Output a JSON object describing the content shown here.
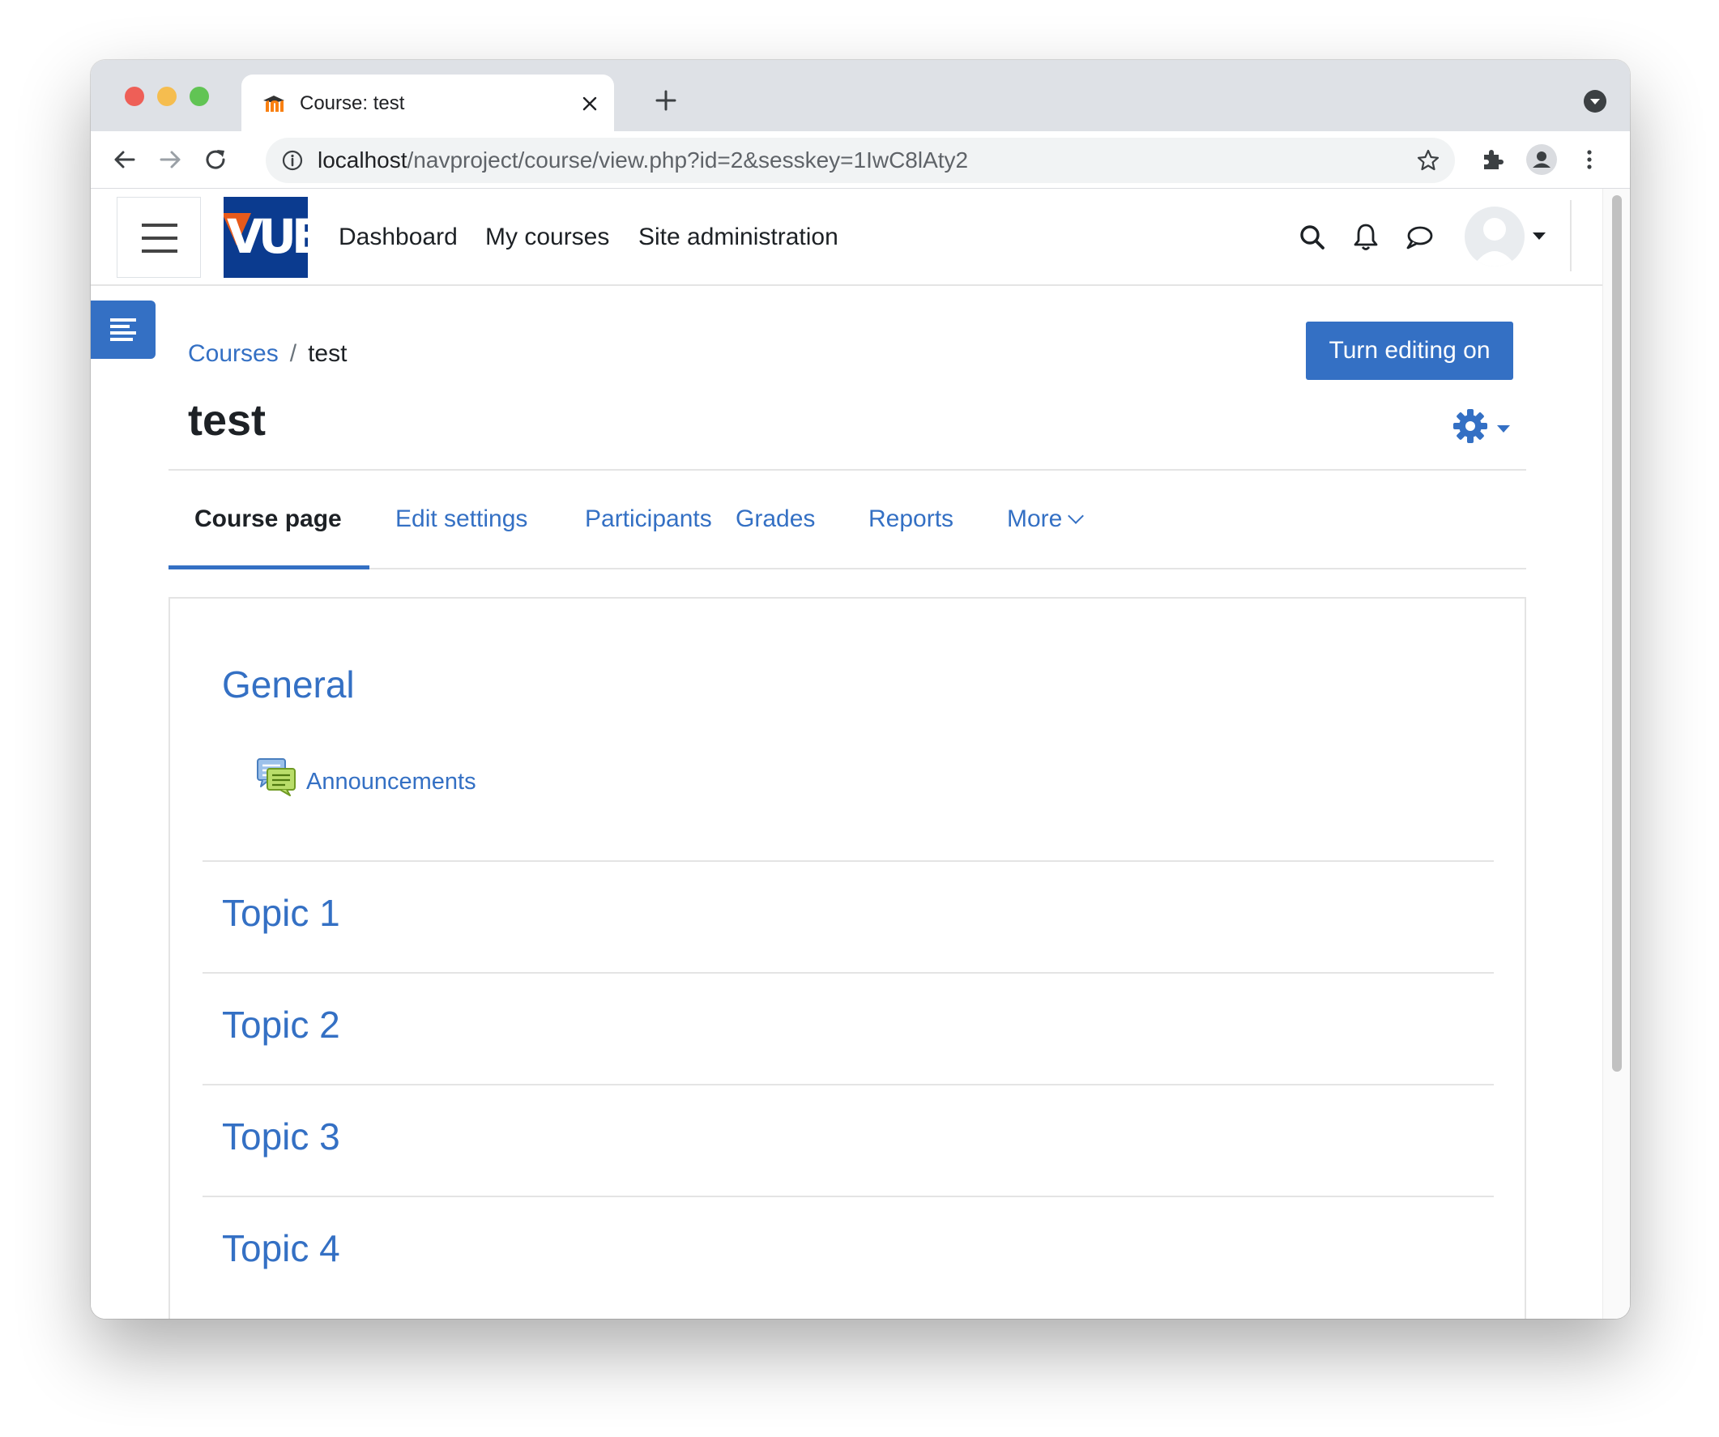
{
  "browser": {
    "tab_title": "Course: test",
    "url_host": "localhost",
    "url_path": "/navproject/course/view.php?id=2&sesskey=1IwC8lAty2"
  },
  "navbar": {
    "logo_text": "VUB",
    "links": [
      "Dashboard",
      "My courses",
      "Site administration"
    ]
  },
  "breadcrumb": {
    "parent": "Courses",
    "separator": "/",
    "current": "test"
  },
  "page": {
    "title": "test",
    "edit_button": "Turn editing on"
  },
  "course_tabs": [
    {
      "label": "Course page",
      "active": true
    },
    {
      "label": "Edit settings",
      "active": false
    },
    {
      "label": "Participants",
      "active": false
    },
    {
      "label": "Grades",
      "active": false
    },
    {
      "label": "Reports",
      "active": false
    },
    {
      "label": "More",
      "active": false
    }
  ],
  "sections": [
    {
      "title": "General",
      "activities": [
        {
          "label": "Announcements",
          "icon": "forum-icon"
        }
      ]
    },
    {
      "title": "Topic 1"
    },
    {
      "title": "Topic 2"
    },
    {
      "title": "Topic 3"
    },
    {
      "title": "Topic 4"
    }
  ],
  "colors": {
    "accent": "#3470c4",
    "logo_bg": "#0b3b8f",
    "text": "#1d2125"
  }
}
